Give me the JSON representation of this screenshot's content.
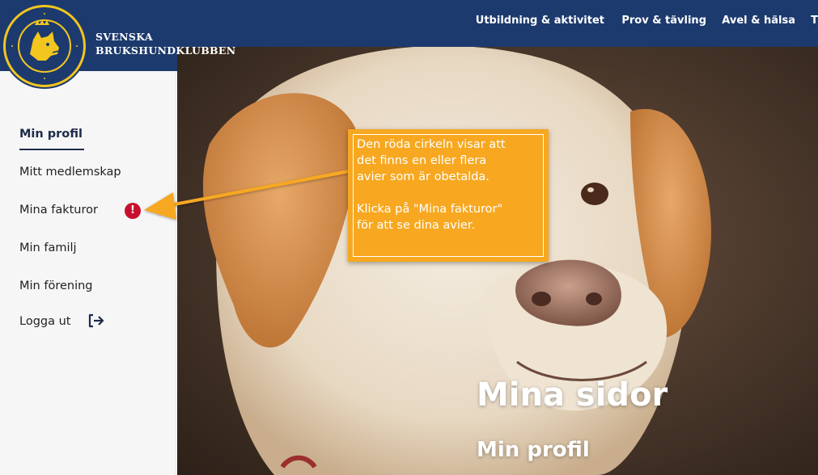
{
  "header": {
    "brand_line1": "SVENSKA",
    "brand_line2": "BRUKSHUNDKLUBBEN",
    "logo_ring_text": "SVENSKA BRUKSHUNDKLUBBEN",
    "nav": [
      {
        "label": "Utbildning & aktivitet"
      },
      {
        "label": "Prov & tävling"
      },
      {
        "label": "Avel & hälsa"
      },
      {
        "label": "T"
      }
    ]
  },
  "sidebar": {
    "items": [
      {
        "label": "Min profil",
        "active": true
      },
      {
        "label": "Mitt medlemskap"
      },
      {
        "label": "Mina fakturor",
        "badge": "!"
      },
      {
        "label": "Min familj"
      },
      {
        "label": "Min förening"
      },
      {
        "label": "Logga ut",
        "icon": "logout-icon"
      }
    ]
  },
  "hero": {
    "title": "Mina sidor",
    "subtitle": "Min profil"
  },
  "callout": {
    "text": "Den röda cirkeln visar att\ndet finns en eller flera\navier som är obetalda.\n\nKlicka på \"Mina fakturor\"\nför att se dina avier."
  },
  "colors": {
    "brand_blue": "#1d3a6e",
    "brand_gold": "#f2c61f",
    "alert_red": "#c8102e",
    "callout_orange": "#f7a820"
  }
}
